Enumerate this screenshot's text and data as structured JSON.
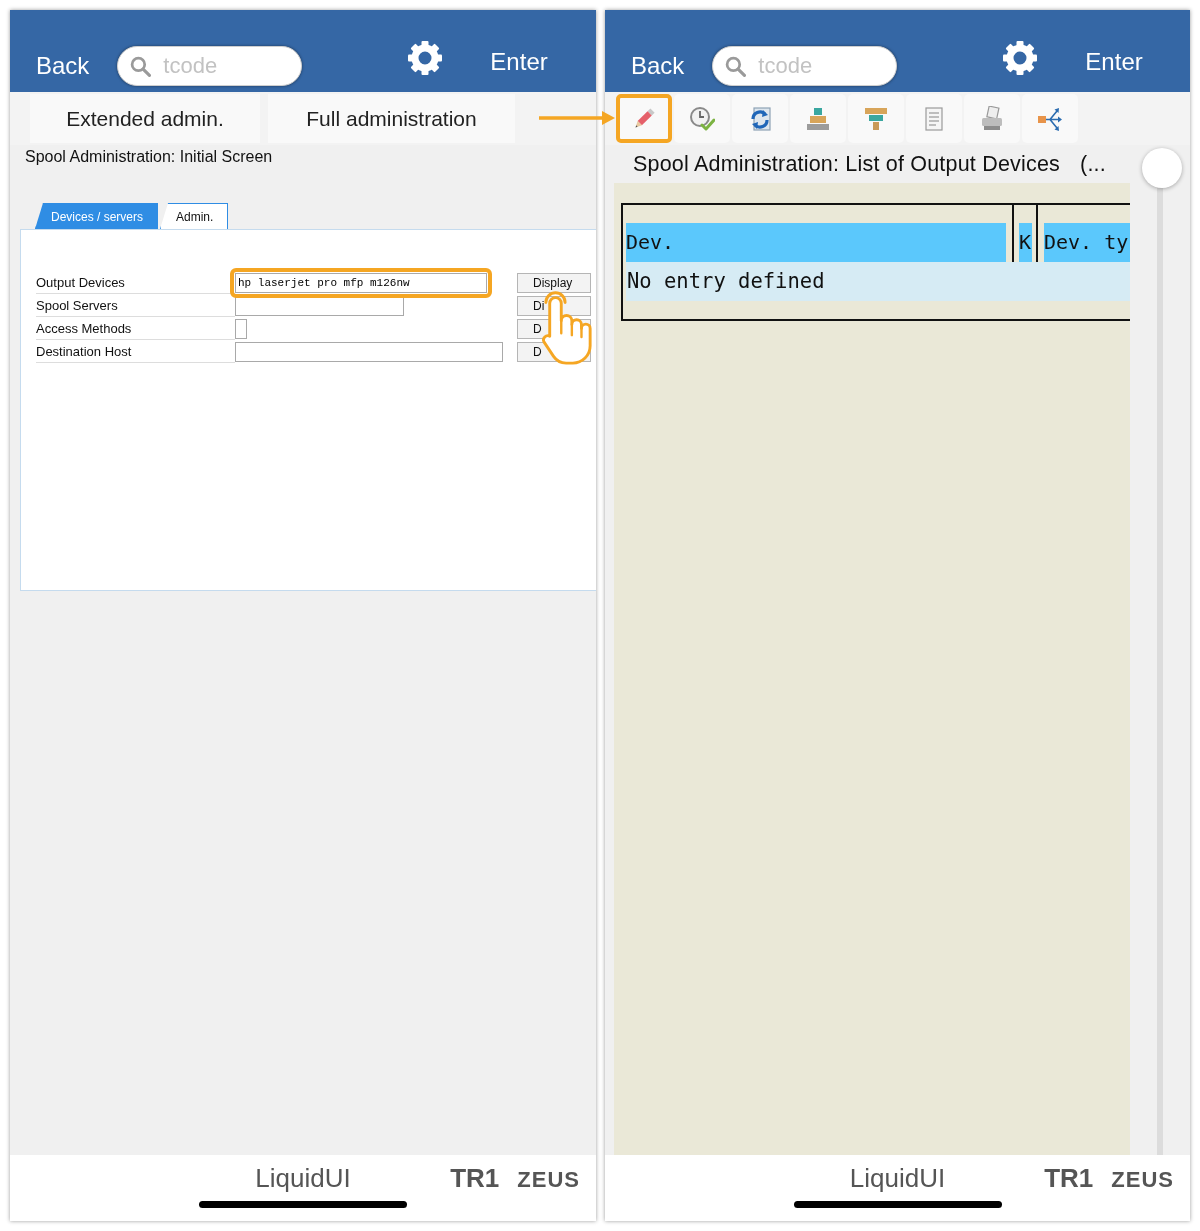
{
  "left_screen": {
    "header": {
      "back": "Back",
      "search_placeholder": "tcode",
      "enter": "Enter"
    },
    "action_buttons": [
      "Extended admin.",
      "Full administration"
    ],
    "title": "Spool Administration: Initial Screen",
    "tabs": [
      {
        "label": "Devices / servers",
        "selected": true
      },
      {
        "label": "Admin.",
        "selected": false
      }
    ],
    "form": [
      {
        "label": "Output Devices",
        "value": "hp laserjet pro mfp m126nw",
        "button": "Display",
        "highlighted": true,
        "tapped": true
      },
      {
        "label": "Spool Servers",
        "button": "Di",
        "highlighted": false,
        "tapped": false
      },
      {
        "label": "Access Methods",
        "button": "D",
        "highlighted": false,
        "tapped": false
      },
      {
        "label": "Destination Host",
        "button": "D",
        "highlighted": false,
        "tapped": false
      }
    ],
    "footer": {
      "brand": "LiquidUI",
      "system": "TR1",
      "server": "ZEUS"
    }
  },
  "callout_arrow": true,
  "right_screen": {
    "header": {
      "back": "Back",
      "search_placeholder": "tcode",
      "enter": "Enter"
    },
    "toolbar": [
      {
        "highlighted": true
      },
      {
        "highlighted": false
      },
      {
        "highlighted": false
      },
      {
        "highlighted": false
      },
      {
        "highlighted": false
      },
      {
        "highlighted": false
      },
      {
        "highlighted": false
      },
      {
        "highlighted": false
      }
    ],
    "title": "Spool Administration: List of Output Devices",
    "title_overflow": "(...",
    "table": {
      "columns": [
        "Dev.",
        "K",
        "Dev. ty"
      ],
      "empty_message": "No entry defined"
    },
    "footer": {
      "brand": "LiquidUI",
      "system": "TR1",
      "server": "ZEUS"
    }
  }
}
